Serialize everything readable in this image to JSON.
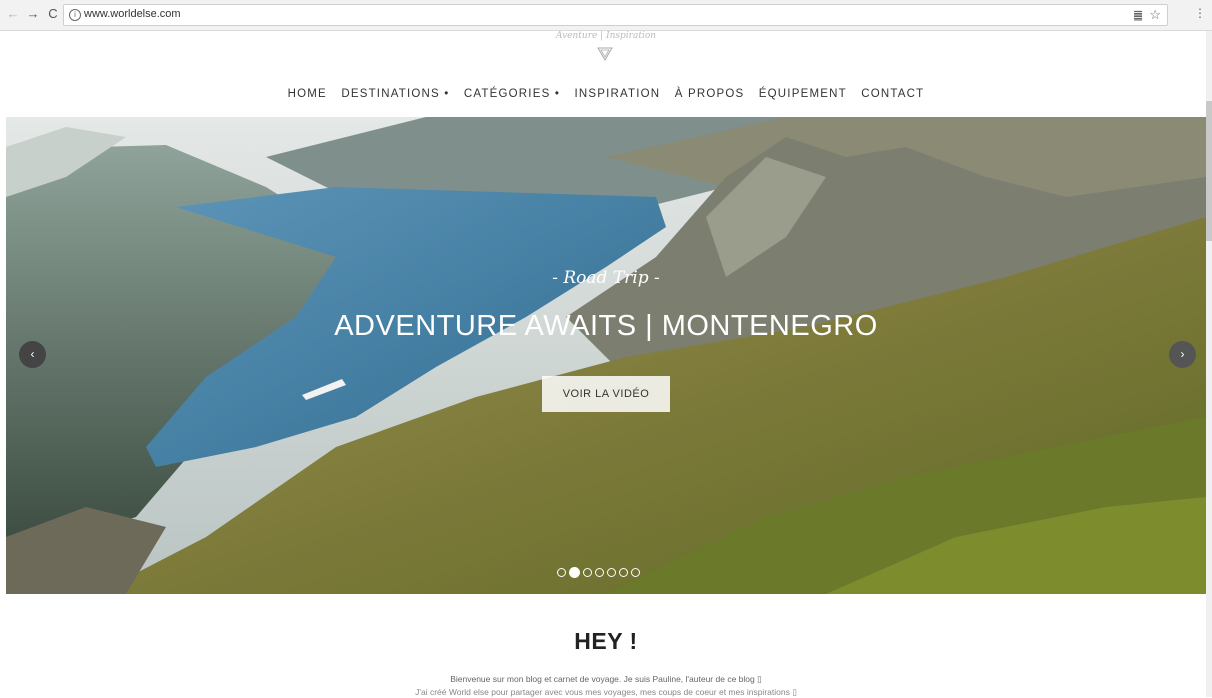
{
  "browser": {
    "url": "www.worldelse.com",
    "back_glyph": "←",
    "forward_glyph": "→",
    "reload_glyph": "C",
    "info_glyph": "i",
    "reader_glyph": "䷀",
    "star_glyph": "☆",
    "menu_glyph": "⋮"
  },
  "header": {
    "tagline": "Aventure | Inspiration",
    "nav": [
      "HOME",
      "DESTINATIONS •",
      "CATÉGORIES •",
      "INSPIRATION",
      "À PROPOS",
      "ÉQUIPEMENT",
      "CONTACT"
    ]
  },
  "hero": {
    "subtitle": "- Road Trip -",
    "title": "ADVENTURE AWAITS | MONTENEGRO",
    "button_label": "VOIR LA VIDÉO",
    "prev_glyph": "‹",
    "next_glyph": "›",
    "slide_count": 7,
    "active_slide": 2
  },
  "intro": {
    "heading": "HEY !",
    "line1": "Bienvenue sur mon blog et carnet de voyage. Je suis Pauline, l'auteur de ce blog ▯",
    "line2": "J'ai créé World else pour partager avec vous mes voyages, mes coups de coeur et mes inspirations ▯"
  },
  "colors": {
    "water": "#3f7fa6",
    "hillside": "#8a8a3c",
    "sky": "#d9dfe2"
  }
}
